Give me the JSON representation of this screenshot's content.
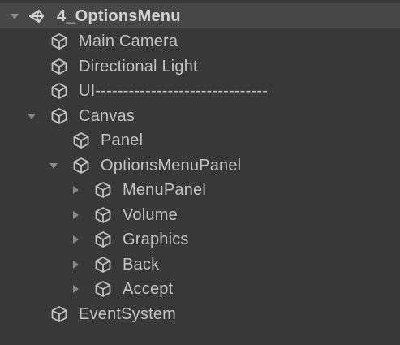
{
  "scene": {
    "name": "4_OptionsMenu",
    "icon": "unity-scene-icon",
    "expanded": true
  },
  "items": [
    {
      "label": "Main Camera",
      "depth": 0,
      "foldout": "none",
      "icon": "gameobject-cube-icon"
    },
    {
      "label": "Directional Light",
      "depth": 0,
      "foldout": "none",
      "icon": "gameobject-cube-icon"
    },
    {
      "label": "UI-------------------------------",
      "depth": 0,
      "foldout": "none",
      "icon": "gameobject-cube-icon"
    },
    {
      "label": "Canvas",
      "depth": 0,
      "foldout": "expanded",
      "icon": "gameobject-cube-icon"
    },
    {
      "label": "Panel",
      "depth": 1,
      "foldout": "none",
      "icon": "gameobject-cube-icon"
    },
    {
      "label": "OptionsMenuPanel",
      "depth": 1,
      "foldout": "expanded",
      "icon": "gameobject-cube-icon"
    },
    {
      "label": "MenuPanel",
      "depth": 2,
      "foldout": "collapsed",
      "icon": "gameobject-cube-icon"
    },
    {
      "label": "Volume",
      "depth": 2,
      "foldout": "collapsed",
      "icon": "gameobject-cube-icon"
    },
    {
      "label": "Graphics",
      "depth": 2,
      "foldout": "collapsed",
      "icon": "gameobject-cube-icon"
    },
    {
      "label": "Back",
      "depth": 2,
      "foldout": "collapsed",
      "icon": "gameobject-cube-icon"
    },
    {
      "label": "Accept",
      "depth": 2,
      "foldout": "collapsed",
      "icon": "gameobject-cube-icon"
    },
    {
      "label": "EventSystem",
      "depth": 0,
      "foldout": "none",
      "icon": "gameobject-cube-icon"
    }
  ],
  "colors": {
    "background": "#383838",
    "header": "#474747",
    "text": "#c4c4c4",
    "foldout": "#8a8a8a"
  }
}
